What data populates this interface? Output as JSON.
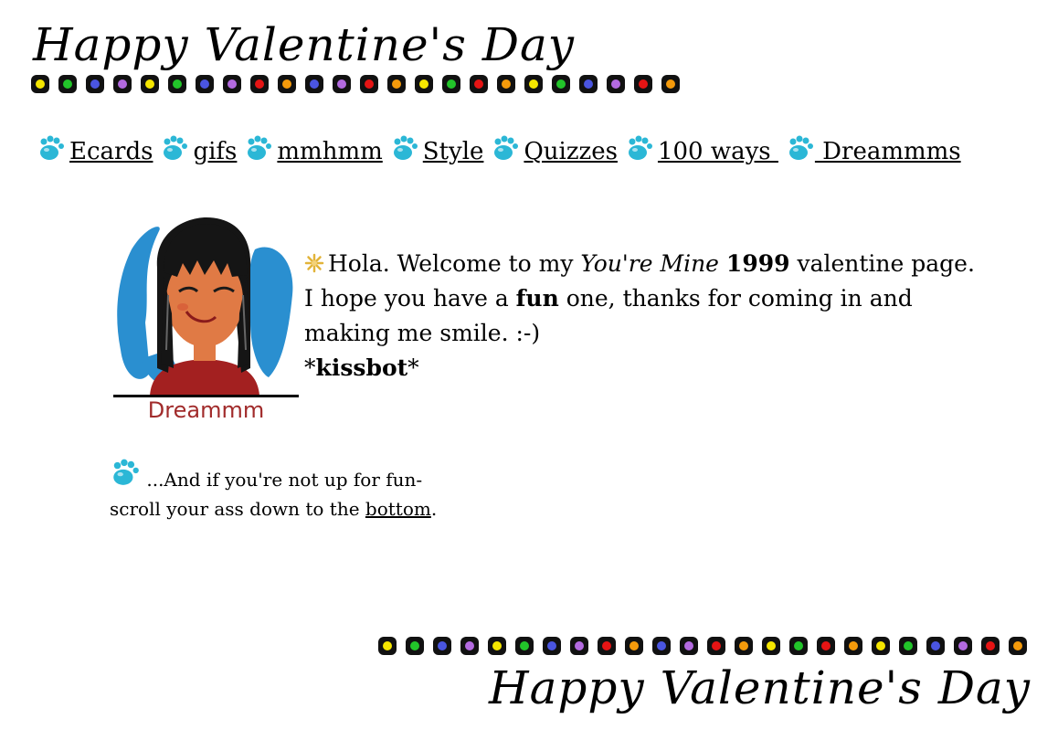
{
  "header": {
    "title": "Happy Valentine's Day"
  },
  "footer": {
    "title": "Happy Valentine's Day"
  },
  "bead_colors_top": [
    "#f5e600",
    "#22c42a",
    "#4a55e0",
    "#b36ae0",
    "#f5e600",
    "#22c42a",
    "#4a55e0",
    "#b36ae0",
    "#e51414",
    "#f49a0b",
    "#4a55e0",
    "#b36ae0",
    "#e51414",
    "#f49a0b",
    "#f5e600",
    "#22c42a",
    "#e51414",
    "#f49a0b",
    "#f5e600",
    "#22c42a",
    "#4a55e0",
    "#b36ae0",
    "#e51414",
    "#f49a0b"
  ],
  "bead_colors_bottom": [
    "#f5e600",
    "#22c42a",
    "#4a55e0",
    "#b36ae0",
    "#f5e600",
    "#22c42a",
    "#4a55e0",
    "#b36ae0",
    "#e51414",
    "#f49a0b",
    "#4a55e0",
    "#b36ae0",
    "#e51414",
    "#f49a0b",
    "#f5e600",
    "#22c42a",
    "#e51414",
    "#f49a0b",
    "#f5e600",
    "#22c42a",
    "#4a55e0",
    "#b36ae0",
    "#e51414",
    "#f49a0b"
  ],
  "nav": {
    "icon": "paw-icon",
    "items": [
      {
        "label": "Ecards"
      },
      {
        "label": "gifs"
      },
      {
        "label": "mmhmm"
      },
      {
        "label": "Style"
      },
      {
        "label": "Quizzes"
      },
      {
        "label": "100 ways "
      },
      {
        "label": " Dreammms"
      }
    ]
  },
  "avatar": {
    "caption": "Dreammm"
  },
  "welcome": {
    "icon": "sparkle-icon",
    "line1_a": "Hola. Welcome to my ",
    "line1_em": "You're Mine",
    "line1_b": " ",
    "line1_year": "1999",
    "line1_c": " valentine page.",
    "line2_a": "I hope you have a ",
    "line2_bold": "fun",
    "line2_b": " one, thanks for coming in and",
    "line3": "making me smile. :-)",
    "line4_a": "*",
    "line4_bold": "kissbot",
    "line4_b": "*"
  },
  "funnote": {
    "icon": "paw-icon",
    "text_a": "...And if you're not up for fun-",
    "text_b": "scroll your ass down to the ",
    "link": "bottom",
    "text_c": "."
  },
  "colors": {
    "paw": "#2bb7d6",
    "sparkle": "#e2b43a",
    "caption": "#a12b2b"
  }
}
